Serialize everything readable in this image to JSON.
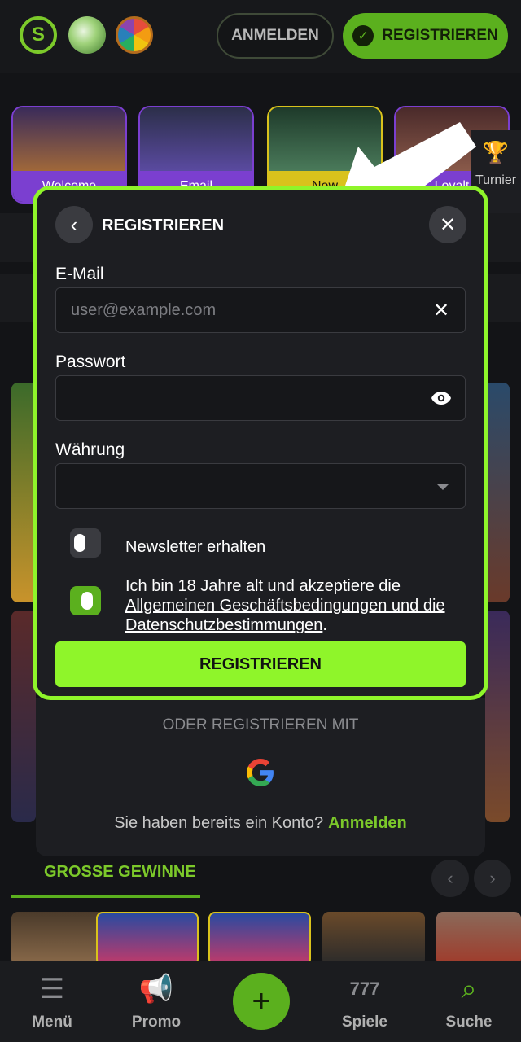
{
  "header": {
    "login_label": "ANMELDEN",
    "register_label": "REGISTRIEREN"
  },
  "promos": [
    {
      "label": "Welcome"
    },
    {
      "label": "Email"
    },
    {
      "label": "New"
    },
    {
      "label": "Loyalt"
    }
  ],
  "tournament_label": "Turnier",
  "modal": {
    "title": "REGISTRIEREN",
    "email_label": "E-Mail",
    "email_placeholder": "user@example.com",
    "password_label": "Passwort",
    "currency_label": "Währung",
    "newsletter_label": "Newsletter erhalten",
    "terms_prefix": "Ich bin 18 Jahre alt und akzeptiere die",
    "terms_link1": "Allgemeinen Geschäftsbedingungen und die",
    "terms_link2": "Datenschutzbestimmungen",
    "terms_suffix": ".",
    "submit_label": "REGISTRIEREN",
    "newsletter_checked": false,
    "terms_checked": true
  },
  "social": {
    "or_text": "ODER REGISTRIEREN MIT",
    "have_account_text": "Sie haben bereits ein Konto?",
    "login_link": "Anmelden"
  },
  "big_wins": {
    "title": "GROSSE GEWINNE"
  },
  "bottom_nav": {
    "menu": "Menü",
    "promo": "Promo",
    "games": "Spiele",
    "search": "Suche"
  },
  "colors": {
    "accent": "#8ff52a",
    "brand_green": "#5bb01e",
    "background": "#131417"
  }
}
